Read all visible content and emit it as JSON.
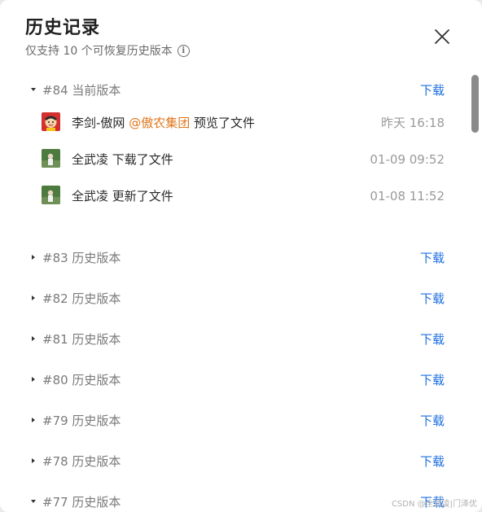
{
  "dialog": {
    "title": "历史记录",
    "subtitle": "仅支持 10 个可恢复历史版本",
    "close_icon": "close-icon",
    "info_icon": "info-icon"
  },
  "current_version": {
    "label": "#84 当前版本",
    "download_label": "下载",
    "expanded": true,
    "activities": [
      {
        "user": "李剑-傲网",
        "mention": "@傲农集团",
        "action": "预览了文件",
        "time": "昨天 16:18",
        "avatar": "cartoon-avatar"
      },
      {
        "user": "全武凌",
        "mention": "",
        "action": "下载了文件",
        "time": "01-09 09:52",
        "avatar": "photo-avatar"
      },
      {
        "user": "全武凌",
        "mention": "",
        "action": "更新了文件",
        "time": "01-08 11:52",
        "avatar": "photo-avatar"
      }
    ]
  },
  "versions": [
    {
      "label": "#83 历史版本",
      "download_label": "下载",
      "expanded": false
    },
    {
      "label": "#82 历史版本",
      "download_label": "下载",
      "expanded": false
    },
    {
      "label": "#81 历史版本",
      "download_label": "下载",
      "expanded": false
    },
    {
      "label": "#80 历史版本",
      "download_label": "下载",
      "expanded": false
    },
    {
      "label": "#79 历史版本",
      "download_label": "下载",
      "expanded": false
    },
    {
      "label": "#78 历史版本",
      "download_label": "下载",
      "expanded": false
    },
    {
      "label": "#77 历史版本",
      "download_label": "下载",
      "expanded": true
    }
  ],
  "watermark": "CSDN @全武凌|门泽优"
}
